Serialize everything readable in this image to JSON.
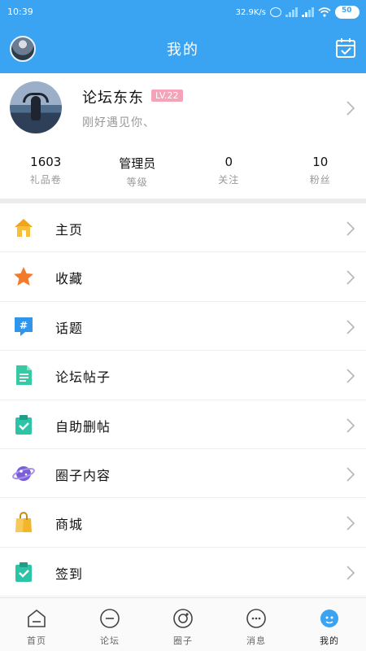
{
  "status_bar": {
    "time": "10:39",
    "net_speed": "32.9K/s",
    "battery": "50"
  },
  "header": {
    "title": "我的"
  },
  "profile": {
    "name": "论坛东东",
    "level": "LV.22",
    "signature": "刚好遇见你、"
  },
  "stats": [
    {
      "value": "1603",
      "label": "礼品卷"
    },
    {
      "value": "管理员",
      "label": "等级"
    },
    {
      "value": "0",
      "label": "关注"
    },
    {
      "value": "10",
      "label": "粉丝"
    }
  ],
  "menu": [
    {
      "label": "主页",
      "icon": "home-icon",
      "color": "#f2a51a"
    },
    {
      "label": "收藏",
      "icon": "star-icon",
      "color": "#f27a2a"
    },
    {
      "label": "话题",
      "icon": "topic-hash-icon",
      "color": "#2f96ec"
    },
    {
      "label": "论坛帖子",
      "icon": "document-icon",
      "color": "#36c9a3"
    },
    {
      "label": "自助删帖",
      "icon": "clipboard-check-icon",
      "color": "#2bc4a6"
    },
    {
      "label": "圈子内容",
      "icon": "planet-icon",
      "color": "#7b5ed6"
    },
    {
      "label": "商城",
      "icon": "shopping-bag-icon",
      "color": "#f4b52a"
    },
    {
      "label": "签到",
      "icon": "signin-clipboard-icon",
      "color": "#2bc4a6"
    }
  ],
  "tabs": [
    {
      "label": "首页",
      "icon": "home-outline-icon"
    },
    {
      "label": "论坛",
      "icon": "forum-icon"
    },
    {
      "label": "圈子",
      "icon": "circle-icon"
    },
    {
      "label": "消息",
      "icon": "message-icon"
    },
    {
      "label": "我的",
      "icon": "profile-icon"
    }
  ],
  "colors": {
    "accent": "#3aa3f2",
    "level_badge": "#f4a3b8"
  }
}
